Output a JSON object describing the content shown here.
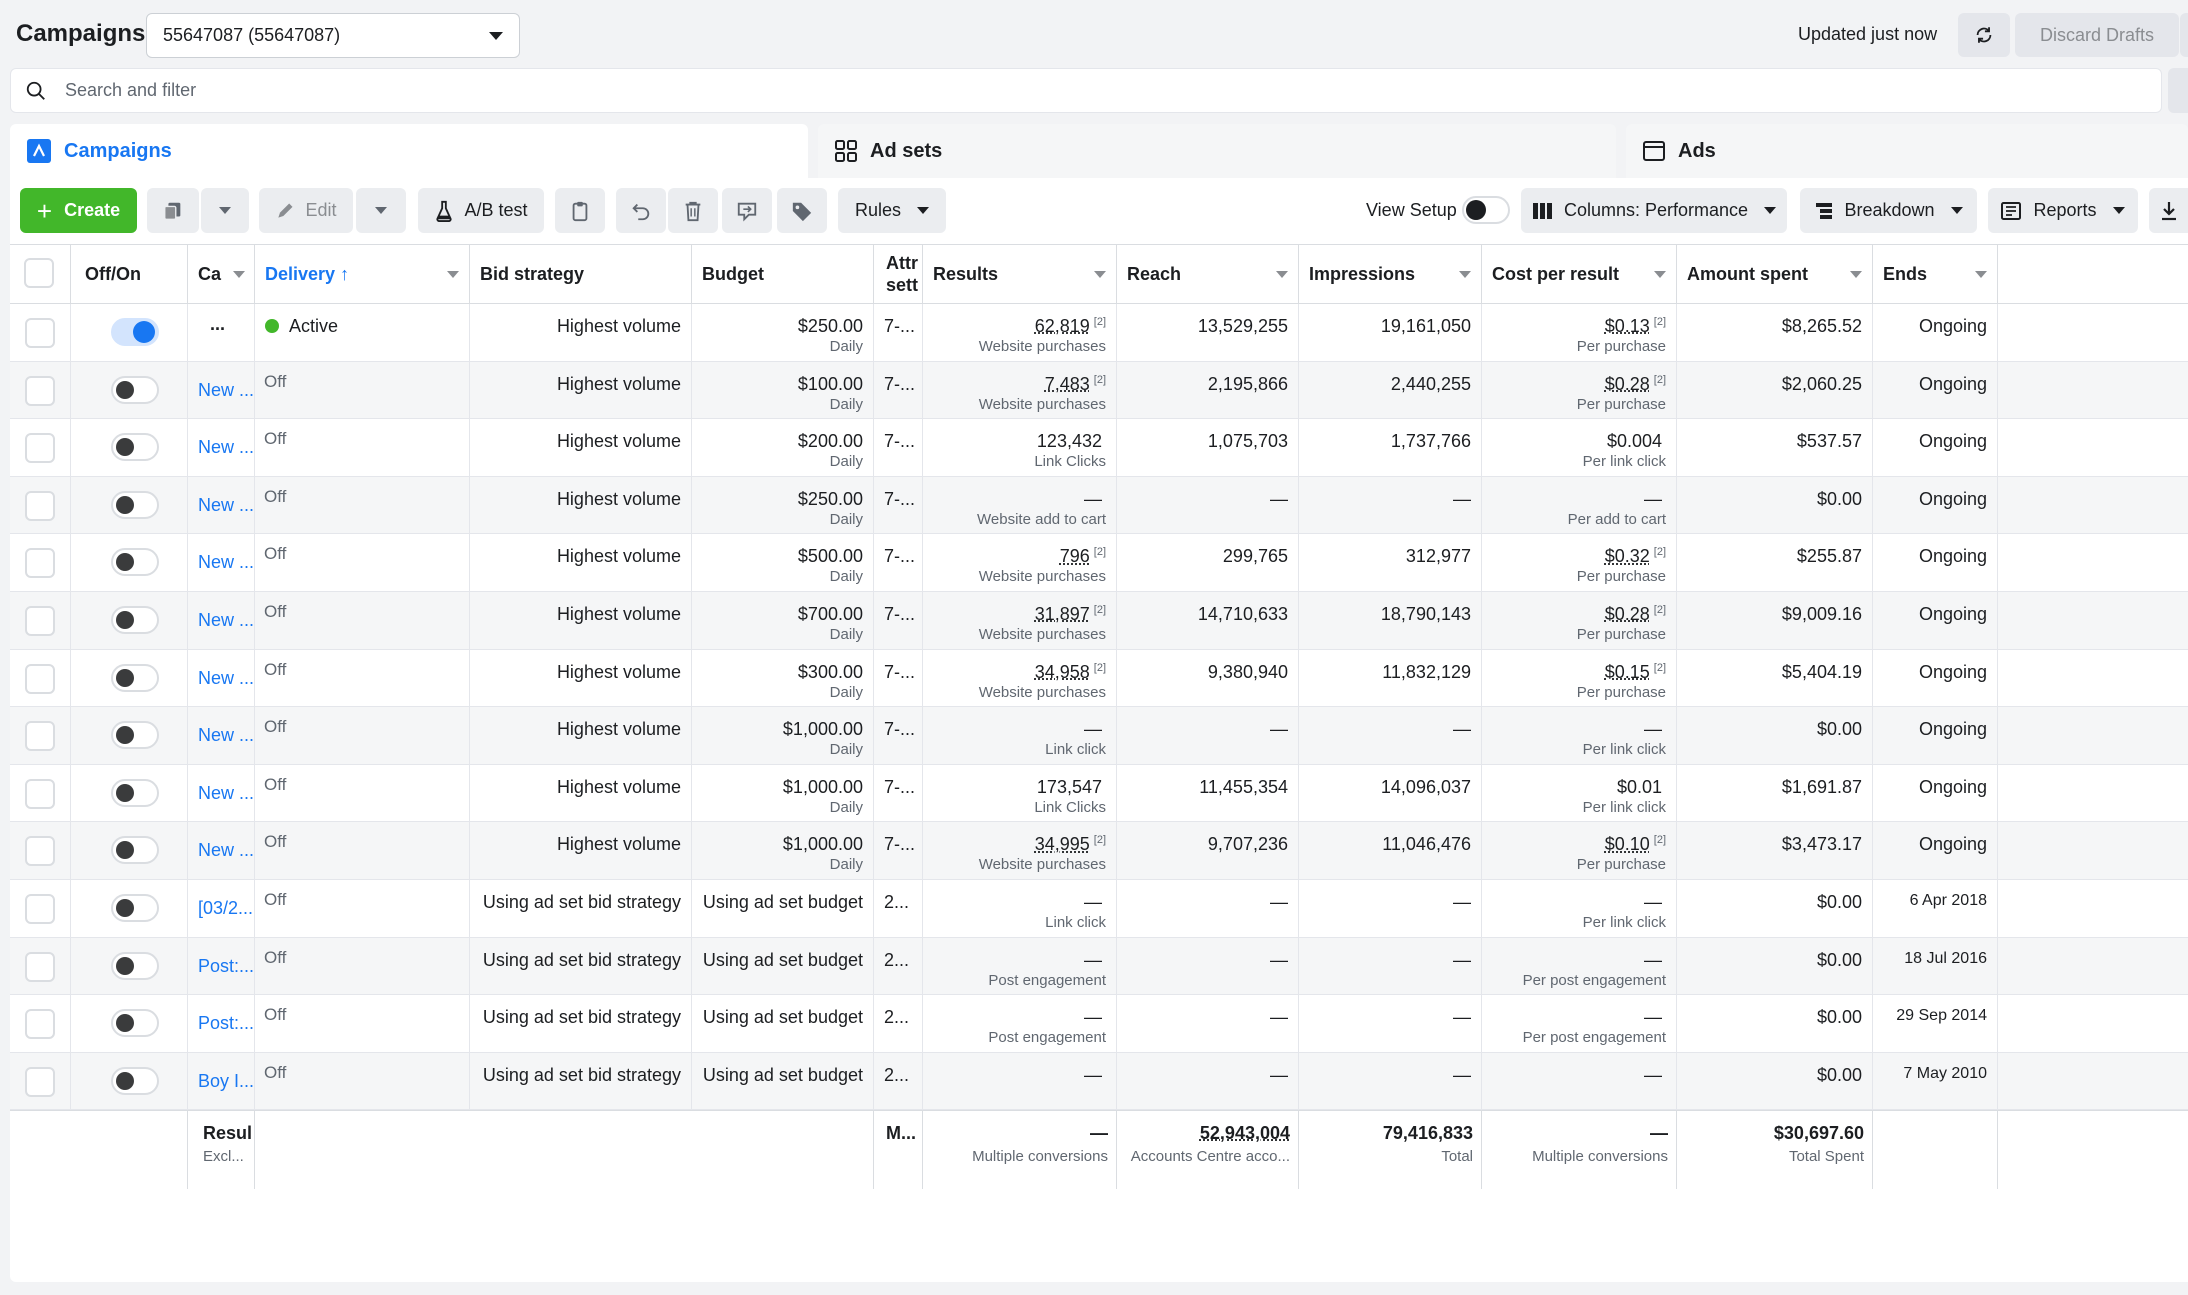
{
  "header": {
    "title": "Campaigns",
    "account": "55647087 (55647087)",
    "updated": "Updated just now",
    "discard": "Discard Drafts"
  },
  "search": {
    "placeholder": "Search and filter"
  },
  "tabs": [
    {
      "label": "Campaigns",
      "icon": "campaign-icon"
    },
    {
      "label": "Ad sets",
      "icon": "grid-icon"
    },
    {
      "label": "Ads",
      "icon": "ad-icon"
    }
  ],
  "toolbar": {
    "create": "Create",
    "edit": "Edit",
    "abtest": "A/B test",
    "rules": "Rules",
    "view_setup": "View Setup",
    "columns": "Columns: Performance",
    "breakdown": "Breakdown",
    "reports": "Reports"
  },
  "columns": {
    "offon": "Off/On",
    "name": "Ca",
    "delivery": "Delivery",
    "bid": "Bid strategy",
    "budget": "Budget",
    "attr_1": "Attr",
    "attr_2": "sett",
    "results": "Results",
    "reach": "Reach",
    "impressions": "Impressions",
    "cpr": "Cost per result",
    "spent": "Amount spent",
    "ends": "Ends"
  },
  "rows": [
    {
      "on": true,
      "name": "...",
      "delivery": "Active",
      "bid": "Highest volume",
      "budget": "$250.00",
      "budget_sub": "Daily",
      "attr": "7-...",
      "results": "62,819",
      "results_sup": "[2]",
      "results_sub": "Website purchases",
      "reach": "13,529,255",
      "impressions": "19,161,050",
      "cpr": "$0.13",
      "cpr_sup": "[2]",
      "cpr_sub": "Per purchase",
      "spent": "$8,265.52",
      "ends": "Ongoing"
    },
    {
      "on": false,
      "name": "New ...",
      "delivery": "Off",
      "bid": "Highest volume",
      "budget": "$100.00",
      "budget_sub": "Daily",
      "attr": "7-...",
      "results": "7,483",
      "results_sup": "[2]",
      "results_sub": "Website purchases",
      "reach": "2,195,866",
      "impressions": "2,440,255",
      "cpr": "$0.28",
      "cpr_sup": "[2]",
      "cpr_sub": "Per purchase",
      "spent": "$2,060.25",
      "ends": "Ongoing"
    },
    {
      "on": false,
      "name": "New ...",
      "delivery": "Off",
      "bid": "Highest volume",
      "budget": "$200.00",
      "budget_sub": "Daily",
      "attr": "7-...",
      "results": "123,432",
      "results_sup": "",
      "results_sub": "Link Clicks",
      "reach": "1,075,703",
      "impressions": "1,737,766",
      "cpr": "$0.004",
      "cpr_sup": "",
      "cpr_sub": "Per link click",
      "spent": "$537.57",
      "ends": "Ongoing"
    },
    {
      "on": false,
      "name": "New ...",
      "delivery": "Off",
      "bid": "Highest volume",
      "budget": "$250.00",
      "budget_sub": "Daily",
      "attr": "7-...",
      "results": "—",
      "results_sup": "",
      "results_sub": "Website add to cart",
      "reach": "—",
      "impressions": "—",
      "cpr": "—",
      "cpr_sup": "",
      "cpr_sub": "Per add to cart",
      "spent": "$0.00",
      "ends": "Ongoing"
    },
    {
      "on": false,
      "name": "New ...",
      "delivery": "Off",
      "bid": "Highest volume",
      "budget": "$500.00",
      "budget_sub": "Daily",
      "attr": "7-...",
      "results": "796",
      "results_sup": "[2]",
      "results_sub": "Website purchases",
      "reach": "299,765",
      "impressions": "312,977",
      "cpr": "$0.32",
      "cpr_sup": "[2]",
      "cpr_sub": "Per purchase",
      "spent": "$255.87",
      "ends": "Ongoing"
    },
    {
      "on": false,
      "name": "New ...",
      "delivery": "Off",
      "bid": "Highest volume",
      "budget": "$700.00",
      "budget_sub": "Daily",
      "attr": "7-...",
      "results": "31,897",
      "results_sup": "[2]",
      "results_sub": "Website purchases",
      "reach": "14,710,633",
      "impressions": "18,790,143",
      "cpr": "$0.28",
      "cpr_sup": "[2]",
      "cpr_sub": "Per purchase",
      "spent": "$9,009.16",
      "ends": "Ongoing"
    },
    {
      "on": false,
      "name": "New ...",
      "delivery": "Off",
      "bid": "Highest volume",
      "budget": "$300.00",
      "budget_sub": "Daily",
      "attr": "7-...",
      "results": "34,958",
      "results_sup": "[2]",
      "results_sub": "Website purchases",
      "reach": "9,380,940",
      "impressions": "11,832,129",
      "cpr": "$0.15",
      "cpr_sup": "[2]",
      "cpr_sub": "Per purchase",
      "spent": "$5,404.19",
      "ends": "Ongoing"
    },
    {
      "on": false,
      "name": "New ...",
      "delivery": "Off",
      "bid": "Highest volume",
      "budget": "$1,000.00",
      "budget_sub": "Daily",
      "attr": "7-...",
      "results": "—",
      "results_sup": "",
      "results_sub": "Link click",
      "reach": "—",
      "impressions": "—",
      "cpr": "—",
      "cpr_sup": "",
      "cpr_sub": "Per link click",
      "spent": "$0.00",
      "ends": "Ongoing"
    },
    {
      "on": false,
      "name": "New ...",
      "delivery": "Off",
      "bid": "Highest volume",
      "budget": "$1,000.00",
      "budget_sub": "Daily",
      "attr": "7-...",
      "results": "173,547",
      "results_sup": "",
      "results_sub": "Link Clicks",
      "reach": "11,455,354",
      "impressions": "14,096,037",
      "cpr": "$0.01",
      "cpr_sup": "",
      "cpr_sub": "Per link click",
      "spent": "$1,691.87",
      "ends": "Ongoing"
    },
    {
      "on": false,
      "name": "New ...",
      "delivery": "Off",
      "bid": "Highest volume",
      "budget": "$1,000.00",
      "budget_sub": "Daily",
      "attr": "7-...",
      "results": "34,995",
      "results_sup": "[2]",
      "results_sub": "Website purchases",
      "reach": "9,707,236",
      "impressions": "11,046,476",
      "cpr": "$0.10",
      "cpr_sup": "[2]",
      "cpr_sub": "Per purchase",
      "spent": "$3,473.17",
      "ends": "Ongoing"
    },
    {
      "on": false,
      "name": "[03/2...",
      "delivery": "Off",
      "bid": "Using ad set bid strategy",
      "budget": "Using ad set budget",
      "budget_sub": "",
      "attr": "2...",
      "results": "—",
      "results_sup": "",
      "results_sub": "Link click",
      "reach": "—",
      "impressions": "—",
      "cpr": "—",
      "cpr_sup": "",
      "cpr_sub": "Per link click",
      "spent": "$0.00",
      "ends": "6 Apr 2018"
    },
    {
      "on": false,
      "name": "Post:...",
      "delivery": "Off",
      "bid": "Using ad set bid strategy",
      "budget": "Using ad set budget",
      "budget_sub": "",
      "attr": "2...",
      "results": "—",
      "results_sup": "",
      "results_sub": "Post engagement",
      "reach": "—",
      "impressions": "—",
      "cpr": "—",
      "cpr_sup": "",
      "cpr_sub": "Per post engagement",
      "spent": "$0.00",
      "ends": "18 Jul 2016"
    },
    {
      "on": false,
      "name": "Post:...",
      "delivery": "Off",
      "bid": "Using ad set bid strategy",
      "budget": "Using ad set budget",
      "budget_sub": "",
      "attr": "2...",
      "results": "—",
      "results_sup": "",
      "results_sub": "Post engagement",
      "reach": "—",
      "impressions": "—",
      "cpr": "—",
      "cpr_sup": "",
      "cpr_sub": "Per post engagement",
      "spent": "$0.00",
      "ends": "29 Sep 2014"
    },
    {
      "on": false,
      "name": "Boy I...",
      "delivery": "Off",
      "bid": "Using ad set bid strategy",
      "budget": "Using ad set budget",
      "budget_sub": "",
      "attr": "2...",
      "results": "—",
      "results_sup": "",
      "results_sub": "",
      "reach": "—",
      "impressions": "—",
      "cpr": "—",
      "cpr_sup": "",
      "cpr_sub": "",
      "spent": "$0.00",
      "ends": "7 May 2010"
    }
  ],
  "footer": {
    "label": "Resul",
    "label_sub": "Excl...",
    "attr": "M...",
    "results": "—",
    "results_sub": "Multiple conversions",
    "reach": "52,943,004",
    "reach_sub": "Accounts Centre acco...",
    "impressions": "79,416,833",
    "impressions_sub": "Total",
    "cpr": "—",
    "cpr_sub": "Multiple conversions",
    "spent": "$30,697.60",
    "spent_sub": "Total Spent"
  },
  "colors": {
    "accent": "#1877f2",
    "create": "#42b72a",
    "active_dot": "#42b72a"
  }
}
